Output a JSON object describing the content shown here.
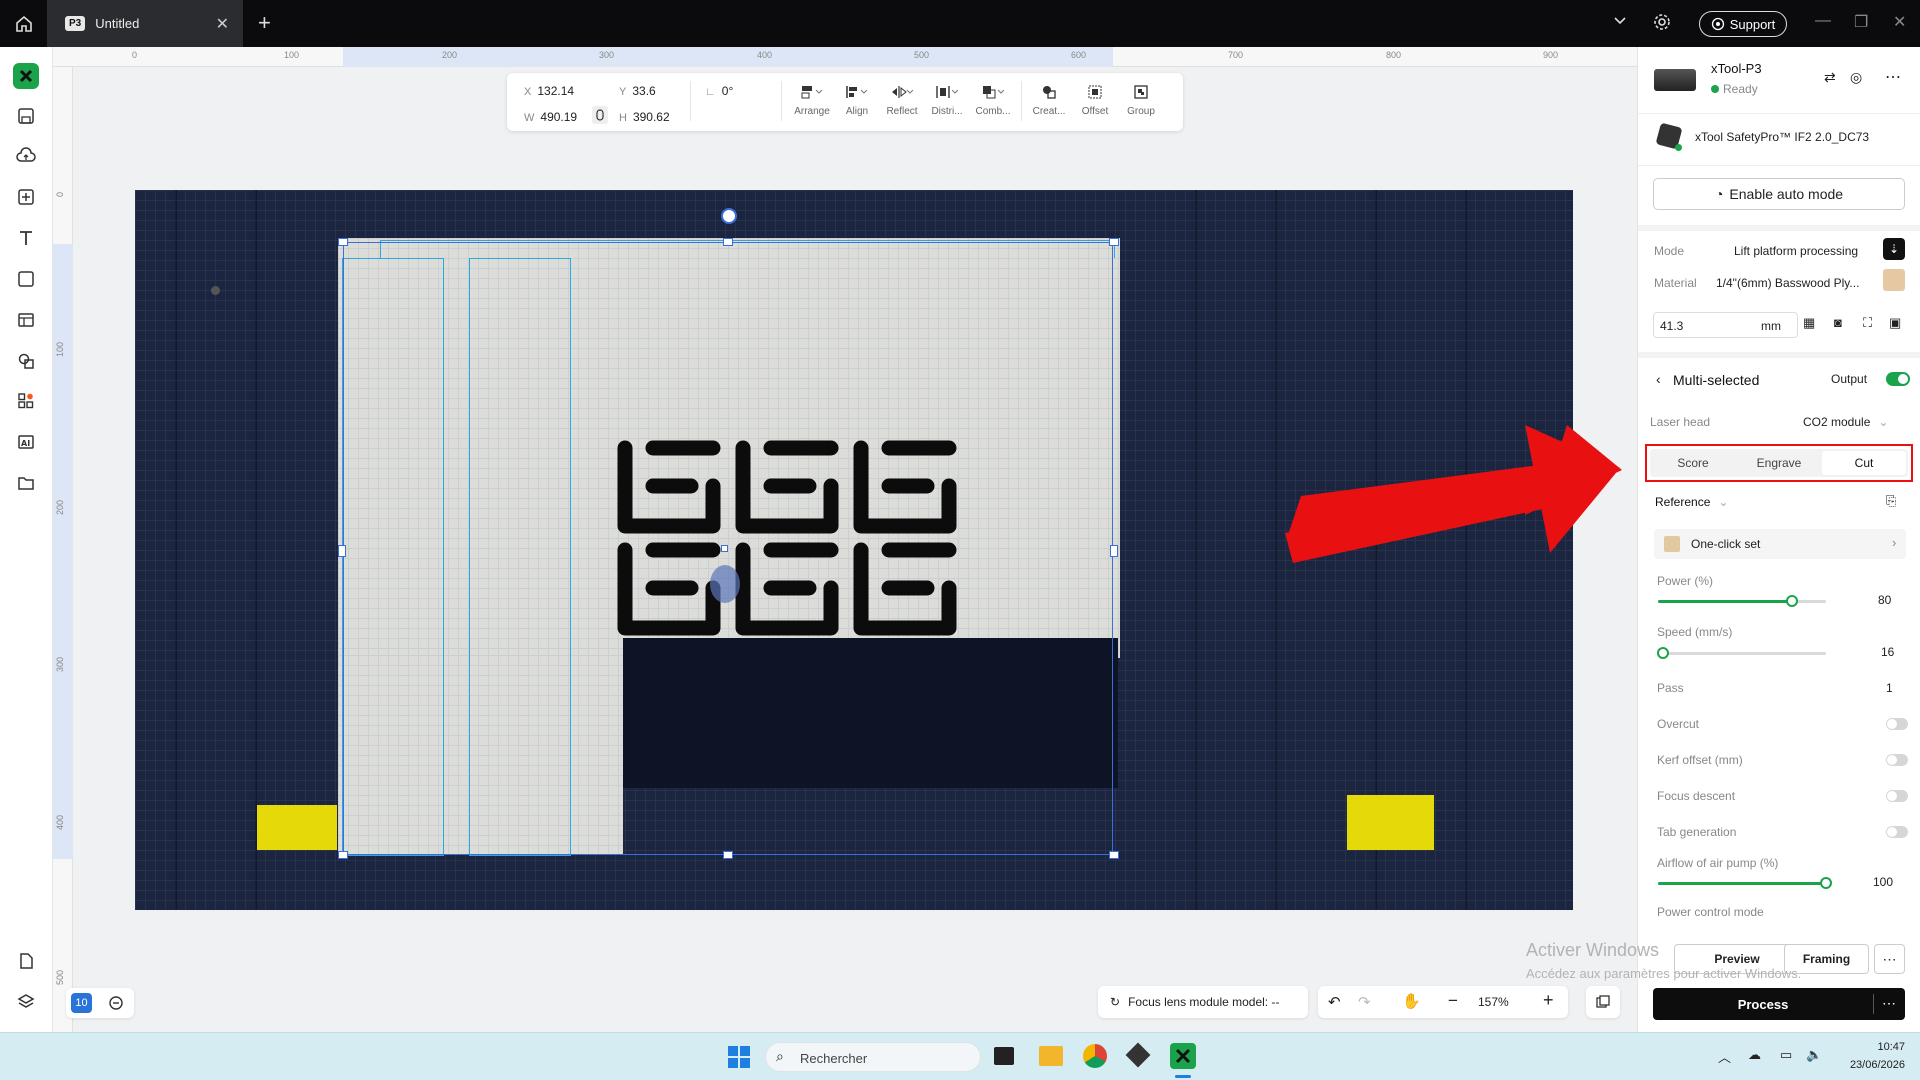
{
  "titlebar": {
    "tab_badge": "P3",
    "tab_title": "Untitled",
    "support_label": "Support"
  },
  "rulers": {
    "top": [
      "0",
      "100",
      "200",
      "300",
      "400",
      "500",
      "600",
      "700",
      "800",
      "900"
    ],
    "left": [
      "0",
      "100",
      "200",
      "300",
      "400",
      "500"
    ]
  },
  "properties": {
    "x_label": "X",
    "x_value": "132.14",
    "y_label": "Y",
    "y_value": "33.6",
    "w_label": "W",
    "w_value": "490.19",
    "h_label": "H",
    "h_value": "390.62",
    "rotation": "0°"
  },
  "toolbar": {
    "arrange": "Arrange",
    "align": "Align",
    "reflect": "Reflect",
    "distribute": "Distri...",
    "combine": "Comb...",
    "create": "Creat...",
    "offset": "Offset",
    "group": "Group"
  },
  "canvas_bottom": {
    "layer_count": "10",
    "focus_lens": "Focus lens module model: --",
    "zoom": "157%"
  },
  "device": {
    "name": "xTool-P3",
    "status": "Ready",
    "accessory": "xTool SafetyPro™ IF2 2.0_DC73",
    "auto_mode": "Enable auto mode"
  },
  "settings": {
    "mode_label": "Mode",
    "mode_value": "Lift platform processing",
    "material_label": "Material",
    "material_value": "1/4\"(6mm) Basswood Ply...",
    "thickness_value": "41.3",
    "thickness_unit": "mm"
  },
  "multi": {
    "title": "Multi-selected",
    "output_label": "Output",
    "laser_head_label": "Laser head",
    "laser_head_value": "CO2 module",
    "tabs": [
      "Score",
      "Engrave",
      "Cut"
    ],
    "active_tab": "Cut",
    "reference_label": "Reference",
    "one_click": "One-click set",
    "power_label": "Power (%)",
    "power_value": "80",
    "power_fraction": 0.8,
    "speed_label": "Speed (mm/s)",
    "speed_value": "16",
    "speed_fraction": 0.03,
    "pass_label": "Pass",
    "pass_value": "1",
    "overcut_label": "Overcut",
    "kerf_label": "Kerf offset (mm)",
    "focus_descent_label": "Focus descent",
    "tab_gen_label": "Tab generation",
    "airflow_label": "Airflow of air pump (%)",
    "airflow_value": "100",
    "airflow_fraction": 1.0,
    "power_mode_label": "Power control mode"
  },
  "actions": {
    "preview": "Preview",
    "framing": "Framing",
    "process": "Process"
  },
  "watermark": {
    "line1": "Activer Windows",
    "line2": "Accédez aux paramètres pour activer Windows."
  },
  "taskbar": {
    "search_placeholder": "Rechercher",
    "time": "10:47",
    "date": "23/06/2026"
  },
  "colors": {
    "accent_green": "#1aa34a",
    "annotation_red": "#e81010",
    "selection_blue": "#3b6fd8"
  }
}
